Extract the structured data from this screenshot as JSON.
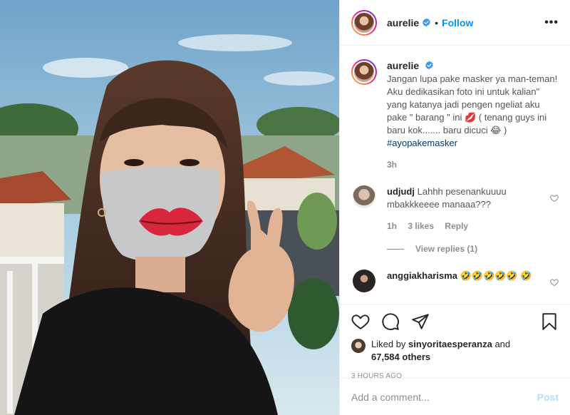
{
  "post": {
    "username": "aurelie",
    "follow_label": "Follow",
    "more_label": "•••",
    "caption": "Jangan lupa pake masker ya man-teman! Aku dedikasikan foto ini untuk kalian\" yang katanya jadi pengen ngeliat aku pake \" barang \" ini 💋 ( tenang guys ini baru kok....... baru dicuci 😂 )",
    "hashtag": "#ayopakemasker",
    "caption_age": "3h"
  },
  "comments": [
    {
      "username": "udjudj",
      "text": "Lahhh pesenankuuuu mbakkkeeee manaaa???",
      "age": "1h",
      "likes": "3 likes",
      "reply_label": "Reply",
      "view_replies": "View replies (1)"
    },
    {
      "username": "anggiakharisma",
      "text": "🤣🤣🤣🤣🤣 🤣"
    }
  ],
  "footer": {
    "liked_by_prefix": "Liked by",
    "liked_by_user": "sinyoritaesperanza",
    "and_label": "and",
    "others_count": "67,584 others",
    "timestamp": "3 HOURS AGO",
    "comment_placeholder": "Add a comment...",
    "post_label": "Post"
  },
  "colors": {
    "accent": "#0095f6",
    "post_disabled": "#b2dffc",
    "muted": "#8e8e8e"
  },
  "icons": [
    "verified-badge-icon",
    "more-options-icon",
    "heart-icon",
    "comment-icon",
    "share-icon",
    "bookmark-icon",
    "small-heart-icon"
  ]
}
